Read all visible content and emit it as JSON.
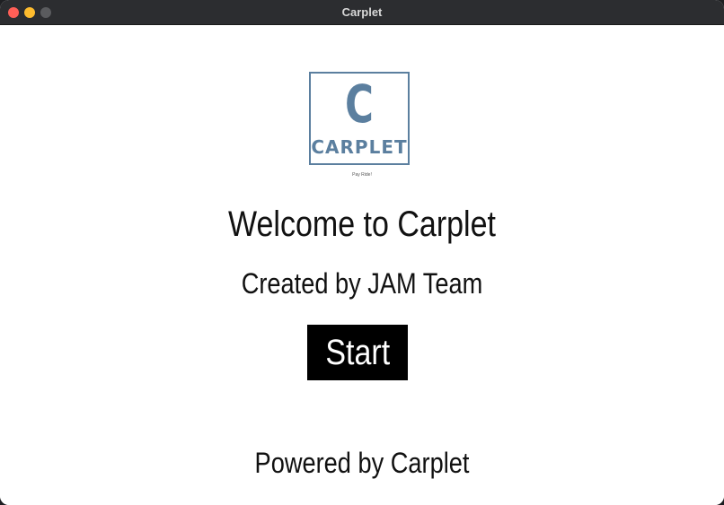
{
  "window": {
    "title": "Carplet"
  },
  "logo": {
    "letter": "C",
    "word": "CARPLET",
    "tagline": "Pay Ride!",
    "color": "#5b7f9f"
  },
  "main": {
    "welcome": "Welcome to Carplet",
    "created_by": "Created by JAM Team",
    "start_label": "Start",
    "powered_by": "Powered by Carplet"
  }
}
